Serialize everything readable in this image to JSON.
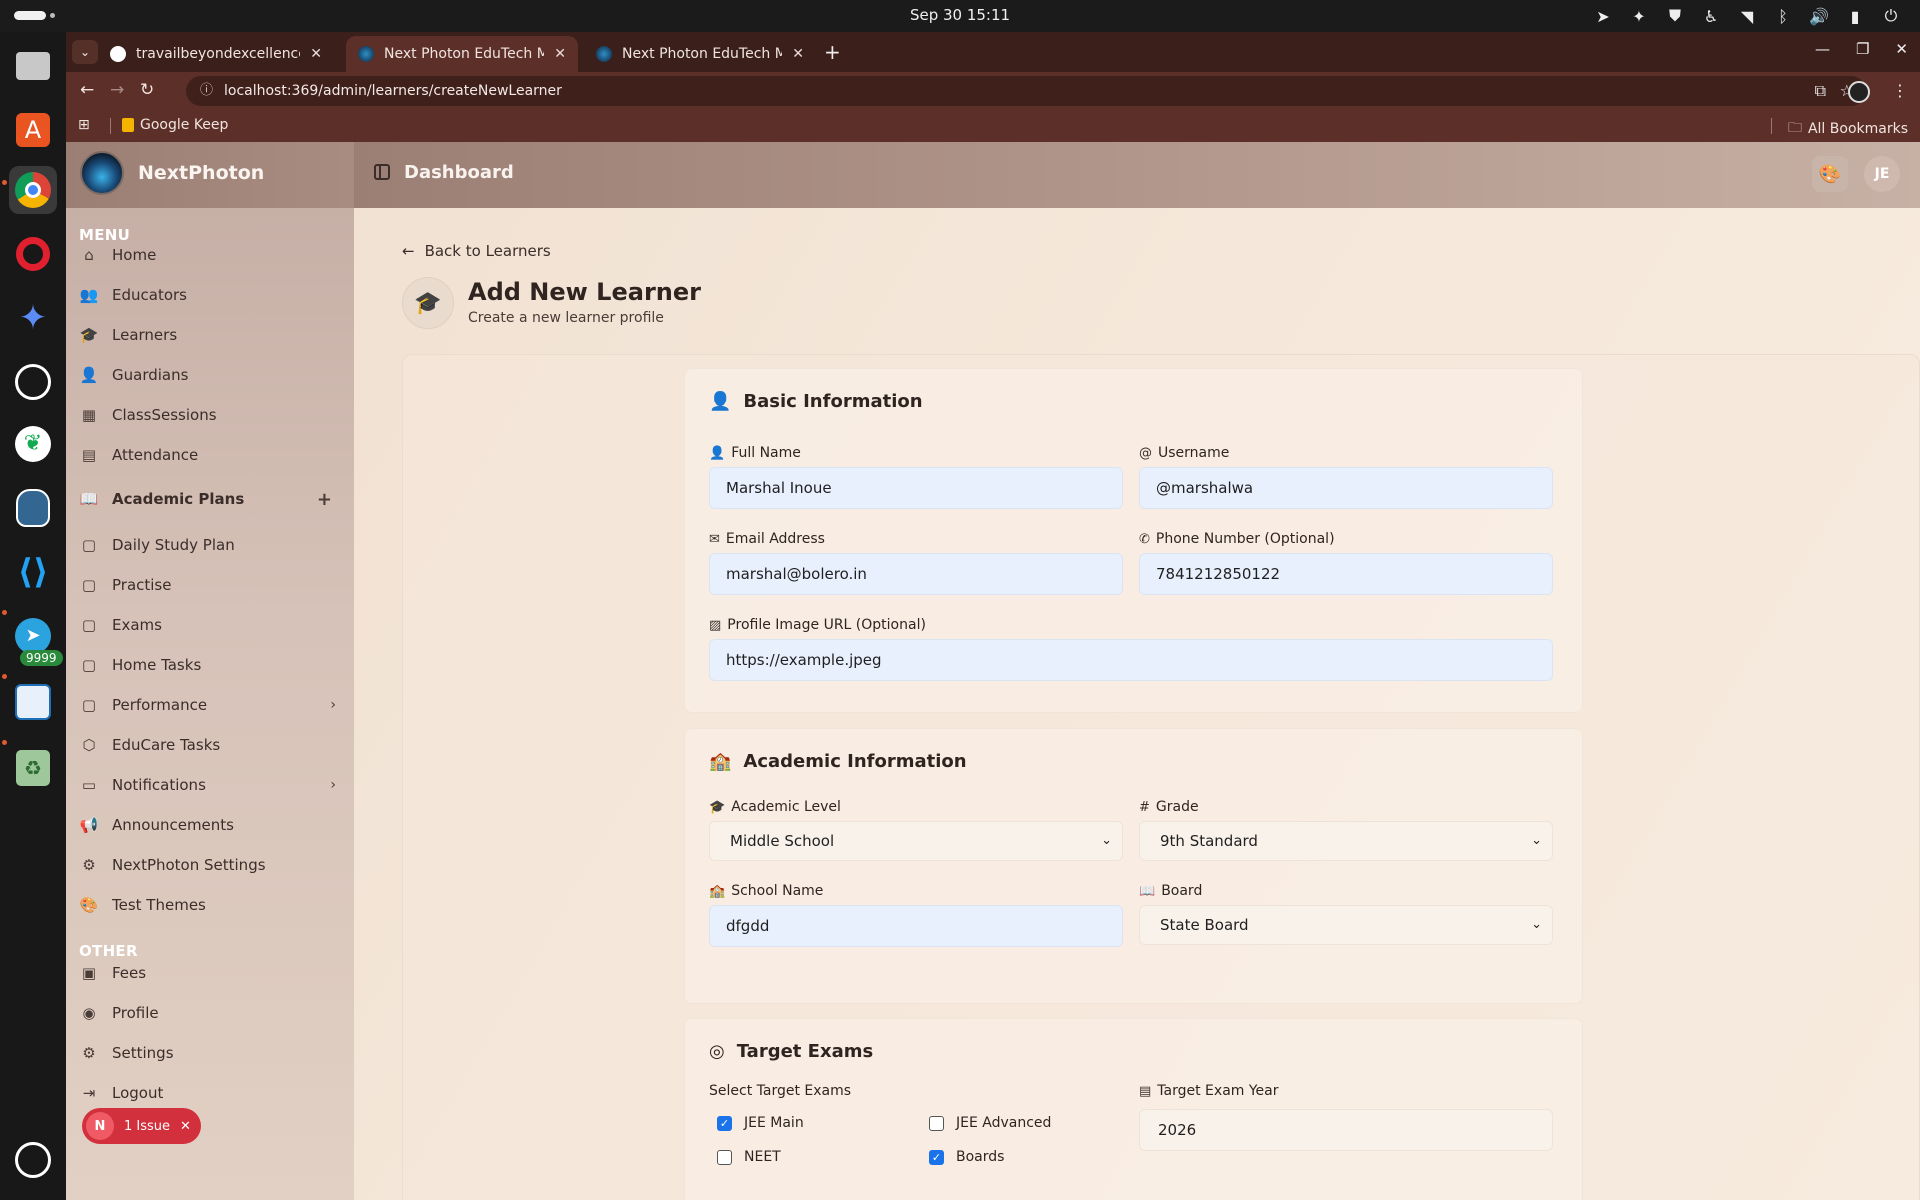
{
  "os": {
    "clock": "Sep 30  15:11",
    "dock_badge": "9999",
    "dock_apps": [
      "files-icon",
      "software-icon",
      "chrome-icon",
      "opera-icon",
      "gemini-icon",
      "chatgpt-icon",
      "mongodb-icon",
      "postgres-icon",
      "vscode-icon",
      "telegram-icon",
      "sheets-icon",
      "trash-icon",
      "ubuntu-icon"
    ]
  },
  "browser": {
    "tabs": [
      {
        "title": "travailbeyondexcellence/",
        "favicon": "github-icon",
        "active": false
      },
      {
        "title": "Next Photon EduTech Ma",
        "favicon": "nextphoton-icon",
        "active": true
      },
      {
        "title": "Next Photon EduTech Ma",
        "favicon": "nextphoton-icon",
        "active": false
      }
    ],
    "url": "localhost:369/admin/learners/createNewLearner",
    "bookmark": "Google Keep",
    "all_bookmarks": "All Bookmarks"
  },
  "app": {
    "brand": "NextPhoton",
    "header_title": "Dashboard",
    "avatar_initials": "JE",
    "menu_heading": "MENU",
    "other_heading": "OTHER",
    "menu": [
      {
        "label": "Home",
        "icon": "home-icon"
      },
      {
        "label": "Educators",
        "icon": "users-icon"
      },
      {
        "label": "Learners",
        "icon": "graduation-cap-icon"
      },
      {
        "label": "Guardians",
        "icon": "user-icon"
      },
      {
        "label": "ClassSessions",
        "icon": "building-icon"
      },
      {
        "label": "Attendance",
        "icon": "calendar-icon"
      },
      {
        "label": "Academic Plans",
        "icon": "book-open-icon"
      },
      {
        "label": "Daily Study Plan",
        "icon": "document-icon"
      },
      {
        "label": "Practise",
        "icon": "document-icon"
      },
      {
        "label": "Exams",
        "icon": "document-icon"
      },
      {
        "label": "Home Tasks",
        "icon": "document-icon"
      },
      {
        "label": "Performance",
        "icon": "document-icon"
      },
      {
        "label": "EduCare Tasks",
        "icon": "package-icon"
      },
      {
        "label": "Notifications",
        "icon": "message-icon"
      },
      {
        "label": "Announcements",
        "icon": "megaphone-icon"
      },
      {
        "label": "NextPhoton Settings",
        "icon": "gear-icon"
      },
      {
        "label": "Test Themes",
        "icon": "palette-icon"
      }
    ],
    "other": [
      {
        "label": "Fees",
        "icon": "wallet-icon"
      },
      {
        "label": "Profile",
        "icon": "user-circle-icon"
      },
      {
        "label": "Settings",
        "icon": "gear-icon"
      },
      {
        "label": "Logout",
        "icon": "logout-icon"
      }
    ],
    "issue": {
      "initial": "N",
      "label": "1 Issue"
    }
  },
  "form": {
    "back_label": "Back to Learners",
    "title": "Add New Learner",
    "subtitle": "Create a new learner profile",
    "basic": {
      "title": "Basic Information",
      "full_name_label": "Full Name",
      "full_name": "Marshal Inoue",
      "username_label": "Username",
      "username": "@marshalwa",
      "email_label": "Email Address",
      "email": "marshal@bolero.in",
      "phone_label": "Phone Number (Optional)",
      "phone": "7841212850122",
      "image_label": "Profile Image URL (Optional)",
      "image": "https://example.jpeg"
    },
    "academic": {
      "title": "Academic Information",
      "level_label": "Academic Level",
      "level": "Middle School",
      "grade_label": "Grade",
      "grade": "9th Standard",
      "school_label": "School Name",
      "school": "dfgdd",
      "board_label": "Board",
      "board": "State Board"
    },
    "targets": {
      "title": "Target Exams",
      "select_label": "Select Target Exams",
      "year_label": "Target Exam Year",
      "year": "2026",
      "exams": [
        {
          "label": "JEE Main",
          "checked": true
        },
        {
          "label": "JEE Advanced",
          "checked": false
        },
        {
          "label": "NEET",
          "checked": false
        },
        {
          "label": "Boards",
          "checked": true
        }
      ]
    }
  }
}
